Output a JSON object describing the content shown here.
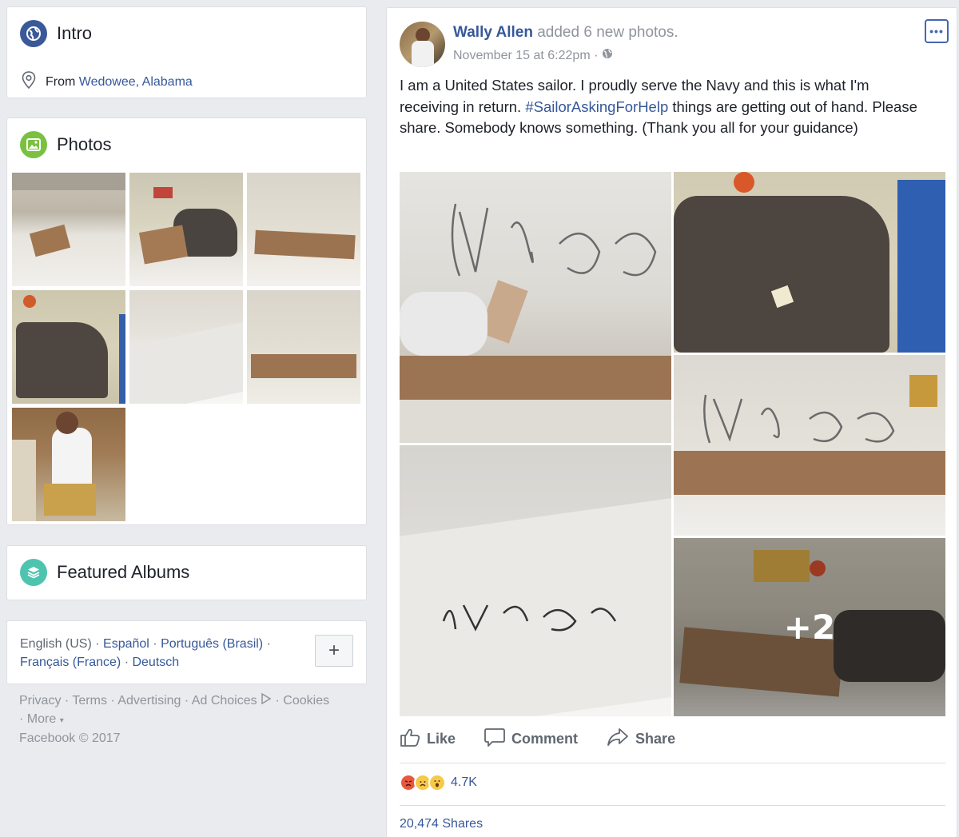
{
  "intro": {
    "title": "Intro",
    "from_label": "From",
    "from_place": "Wedowee, Alabama"
  },
  "photos": {
    "title": "Photos",
    "count_visible": 7
  },
  "featured": {
    "title": "Featured Albums"
  },
  "languages": {
    "current": "English (US)",
    "others": [
      "Español",
      "Português (Brasil)",
      "Français (France)",
      "Deutsch"
    ],
    "add_label": "+"
  },
  "footer": {
    "links": [
      "Privacy",
      "Terms",
      "Advertising",
      "Ad Choices",
      "Cookies",
      "More"
    ],
    "copyright": "Facebook © 2017"
  },
  "post": {
    "author": "Wally Allen",
    "action": "added 6 new photos.",
    "date": "November 15 at 6:22pm",
    "text_before": "I am a United States sailor. I proudly serve the Navy and this is what I'm receiving in return. ",
    "hashtag": "#SailorAskingForHelp",
    "text_after": " things are getting out of hand. Please share. Somebody knows something. (Thank you all for your guidance)",
    "more_photos_label": "+2",
    "actions": {
      "like": "Like",
      "comment": "Comment",
      "share": "Share"
    },
    "reactions_count": "4.7K",
    "shares_count": "20,474 Shares"
  },
  "colors": {
    "brand": "#4267b2",
    "link": "#365899",
    "background": "#e9ebee"
  }
}
